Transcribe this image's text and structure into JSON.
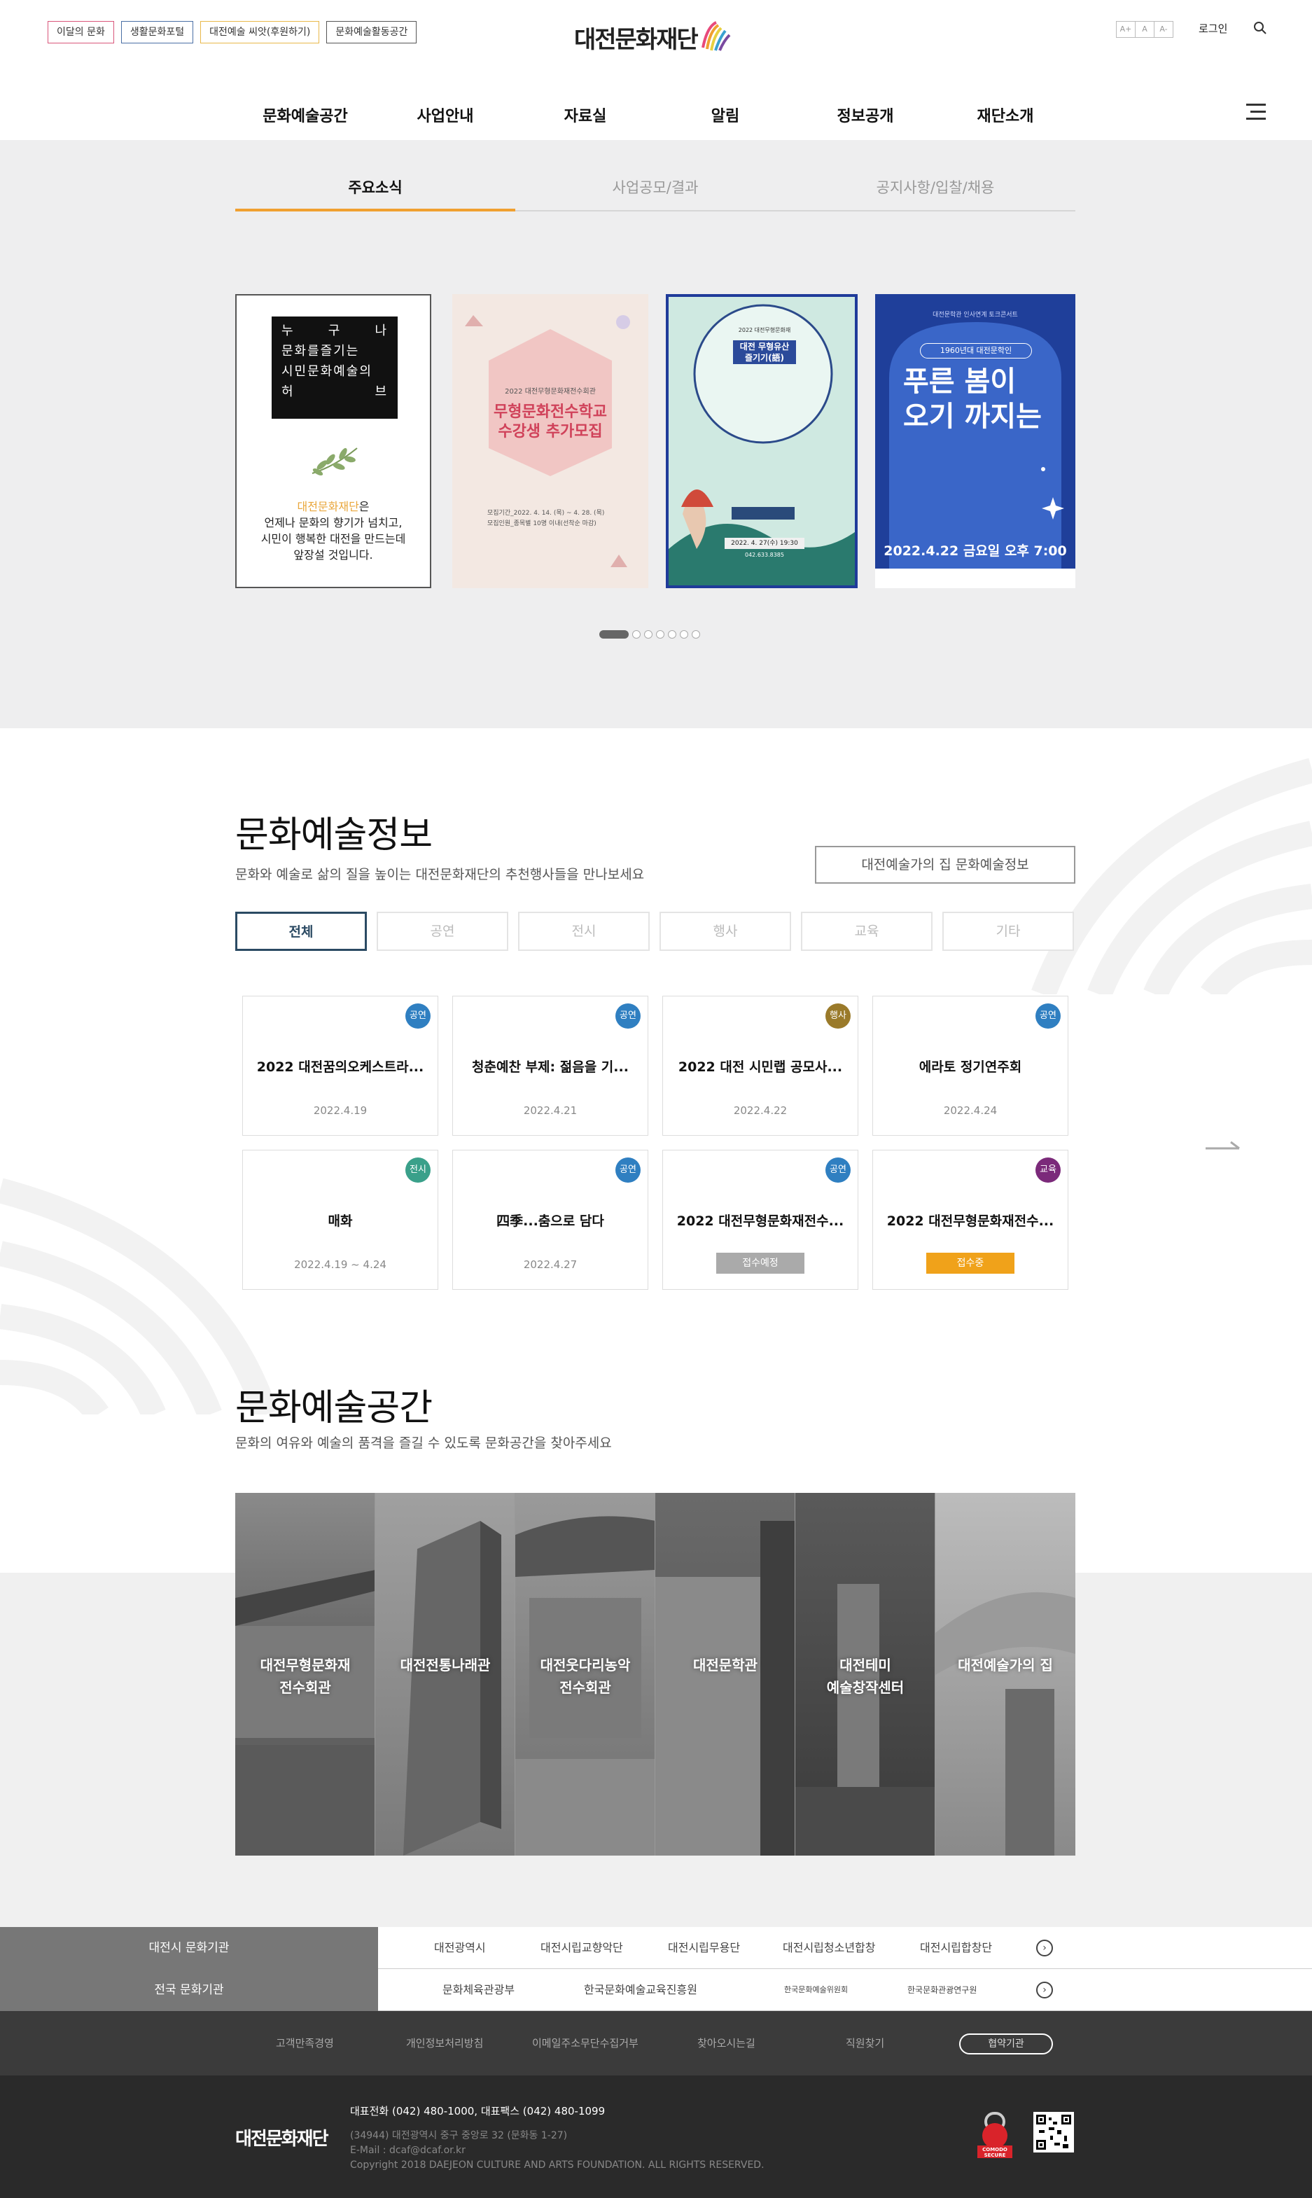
{
  "header": {
    "util_links": [
      {
        "label": "이달의 문화",
        "color": "#d9567a"
      },
      {
        "label": "생활문화포털",
        "color": "#4a6fa5"
      },
      {
        "label": "대전예술 씨앗(후원하기)",
        "color": "#e8b84a"
      },
      {
        "label": "문화예술활동공간",
        "color": "#555555"
      }
    ],
    "logo_text": "대전문화재단",
    "font_size_buttons": [
      "A+",
      "A",
      "A-"
    ],
    "login": "로그인",
    "nav": [
      "문화예술공간",
      "사업안내",
      "자료실",
      "알림",
      "정보공개",
      "재단소개"
    ],
    "icons": {
      "search": "search-icon",
      "menu": "menu-icon"
    }
  },
  "news": {
    "tabs": [
      "주요소식",
      "사업공모/결과",
      "공지사항/입찰/채용"
    ],
    "active_tab": 0,
    "intro_box": [
      "누 구 나",
      "문화를즐기는",
      "시민문화예술의",
      "허 브"
    ],
    "intro_brand": "대전문화재단",
    "intro_brand_suffix": "은",
    "intro_text": [
      "언제나 문화의 향기가 넘치고,",
      "시민이 행복한 대전을 만드는데",
      "앞장설 것입니다."
    ],
    "posters": [
      {
        "small": "2022 대전무형문화재전수회관",
        "big1": "무형문화전수학교",
        "big2": "수강생 추가모집",
        "info1": "모집기간_2022. 4. 14. (목) ~ 4. 28. (목)",
        "info2": "모집인원_종목별 10명 이내(선착순 마감)"
      },
      {
        "small": "2022 대전무형문화재",
        "big1": "대전 무형유산",
        "big2": "즐기기(語)",
        "info1": "2022. 4. 27(수) 19:30",
        "info2": "042.633.8385"
      },
      {
        "small": "대전문학관 인사연계 토크콘서트",
        "big1": "1960년대 대전문학인",
        "big2": "푸른 봄이 오기 까지는",
        "info1": "2022.4.22 금요일 오후 7:00"
      }
    ],
    "slide_count": 7,
    "active_slide": 0
  },
  "culture_info": {
    "title": "문화예술정보",
    "subtitle": "문화와 예술로 삶의 질을 높이는 대전문화재단의 추천행사들을 만나보세요",
    "home_button": "대전예술가의 집 문화예술정보",
    "filters": [
      "전체",
      "공연",
      "전시",
      "행사",
      "교육",
      "기타"
    ],
    "active_filter": 0,
    "events": [
      {
        "badge": "공연",
        "badge_color": "#2f7fc1",
        "title": "2022 대전꿈의오케스트라...",
        "date": "2022.4.19"
      },
      {
        "badge": "공연",
        "badge_color": "#2f7fc1",
        "title": "청춘예찬 부제: 젊음을 기...",
        "date": "2022.4.21"
      },
      {
        "badge": "행사",
        "badge_color": "#9a7a2a",
        "title": "2022 대전 시민랩 공모사...",
        "date": "2022.4.22"
      },
      {
        "badge": "공연",
        "badge_color": "#2f7fc1",
        "title": "에라토 정기연주회",
        "date": "2022.4.24"
      },
      {
        "badge": "전시",
        "badge_color": "#3aa08a",
        "title": "매화",
        "date": "2022.4.19 ~ 4.24"
      },
      {
        "badge": "공연",
        "badge_color": "#2f7fc1",
        "title": "四季...춤으로 담다",
        "date": "2022.4.27"
      },
      {
        "badge": "공연",
        "badge_color": "#2f7fc1",
        "title": "2022 대전무형문화재전수...",
        "status": "접수예정",
        "status_color": "#aaaaaa"
      },
      {
        "badge": "교육",
        "badge_color": "#7b2a7a",
        "title": "2022 대전무형문화재전수...",
        "status": "접수중",
        "status_color": "#f0a21a"
      }
    ]
  },
  "culture_space": {
    "title": "문화예술공간",
    "subtitle": "문화의 여유와 예술의 품격을 즐길 수 있도록 문화공간을 찾아주세요",
    "spaces": [
      {
        "name1": "대전무형문화재",
        "name2": "전수회관"
      },
      {
        "name1": "대전전통나래관",
        "name2": ""
      },
      {
        "name1": "대전웃다리농악",
        "name2": "전수회관"
      },
      {
        "name1": "대전문학관",
        "name2": ""
      },
      {
        "name1": "대전테미",
        "name2": "예술창작센터"
      },
      {
        "name1": "대전예술가의 집",
        "name2": ""
      }
    ]
  },
  "footer": {
    "city_label": "대전시 문화기관",
    "city_orgs": [
      "대전광역시",
      "대전시립교향악단",
      "대전시립무용단",
      "대전시립청소년합창",
      "대전시립합창단"
    ],
    "national_label": "전국 문화기관",
    "national_orgs": [
      "문화체육관광부",
      "한국문화예술교육진흥원",
      "한국문화예술위원회",
      "한국문화관광연구원"
    ],
    "links": [
      "고객만족경영",
      "개인정보처리방침",
      "이메일주소무단수집거부",
      "찾아오시는길",
      "직원찾기"
    ],
    "related_btn": "협약기관",
    "logo": "대전문화재단",
    "tel": "대표전화 (042) 480-1000, 대표팩스 (042) 480-1099",
    "address": "(34944) 대전광역시 중구 중앙로 32 (문화동 1-27)",
    "email": "E-Mail : dcaf@dcaf.or.kr",
    "copyright": "Copyright 2018 DAEJEON CULTURE AND ARTS FOUNDATION. ALL RIGHTS RESERVED.",
    "comodo": "COMODO SECURE"
  }
}
